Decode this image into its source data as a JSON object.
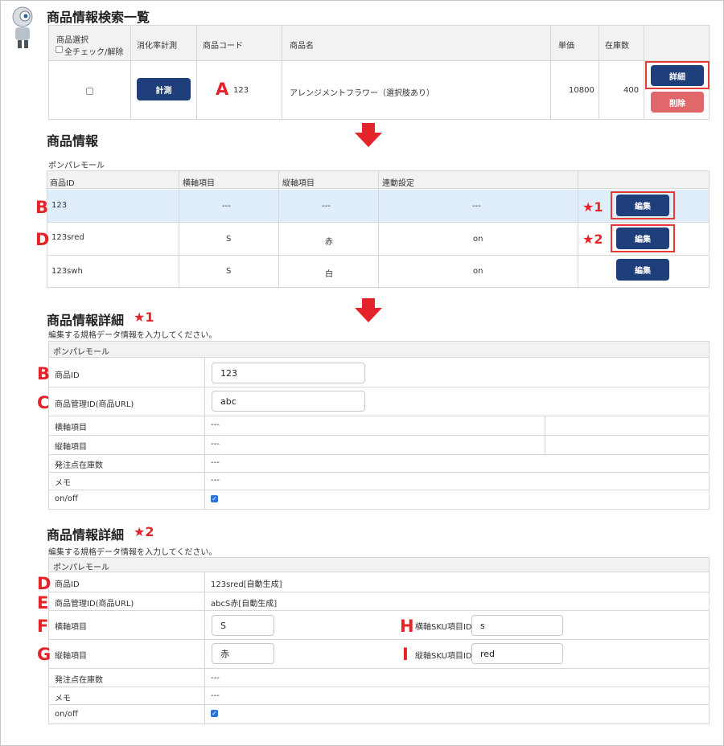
{
  "colors": {
    "navy": "#1f3f7a",
    "red_marker": "#e5232a",
    "delete_btn": "#e0676a",
    "highlight_row": "#dfeefa",
    "header_bg": "#f2f2f2"
  },
  "search": {
    "title": "商品情報検索一覧",
    "columns": [
      "商品選択",
      "消化率計測",
      "商品コード",
      "商品名",
      "単価",
      "在庫数"
    ],
    "check_all": "全チェック/解除",
    "row": {
      "measure_label": "計測",
      "code": "123",
      "name": "アレンジメントフラワー（選択肢あり）",
      "price": "10800",
      "stock": "400"
    },
    "detail_label": "詳細",
    "delete_label": "削除"
  },
  "product_info": {
    "title": "商品情報",
    "store": "ポンパレモール",
    "columns": [
      "商品ID",
      "横軸項目",
      "縦軸項目",
      "連動設定"
    ],
    "edit_label": "編集",
    "rows": [
      {
        "id": "123",
        "h": "---",
        "v": "---",
        "link": "---"
      },
      {
        "id": "123sred",
        "h": "S",
        "v": "赤",
        "link": "on"
      },
      {
        "id": "123swh",
        "h": "S",
        "v": "白",
        "link": "on"
      }
    ]
  },
  "detail1": {
    "title": "商品情報詳細",
    "star": "★1",
    "desc": "編集する規格データ情報を入力してください。",
    "store": "ポンパレモール",
    "labels": [
      "商品ID",
      "商品管理ID(商品URL)",
      "横軸項目",
      "縦軸項目",
      "発注点在庫数",
      "メモ",
      "on/off"
    ],
    "product_id": "123",
    "manage_id": "abc",
    "values": [
      "---",
      "---",
      "---",
      "---"
    ]
  },
  "detail2": {
    "title": "商品情報詳細",
    "star": "★2",
    "desc": "編集する規格データ情報を入力してください。",
    "store": "ポンパレモール",
    "labels": [
      "商品ID",
      "商品管理ID(商品URL)",
      "横軸項目",
      "縦軸項目",
      "発注点在庫数",
      "メモ",
      "on/off"
    ],
    "product_id": "123sred[自動生成]",
    "manage_id": "abcS赤[自動生成]",
    "h_item": "S",
    "v_item": "赤",
    "h_sku_label": "横軸SKU項目ID",
    "v_sku_label": "縦軸SKU項目ID",
    "h_sku": "s",
    "v_sku": "red",
    "values": [
      "---",
      "---"
    ]
  },
  "markers": {
    "A": "A",
    "B": "B",
    "C": "C",
    "D": "D",
    "E": "E",
    "F": "F",
    "G": "G",
    "H": "H",
    "I": "I",
    "star1": "★1",
    "star2": "★2"
  }
}
